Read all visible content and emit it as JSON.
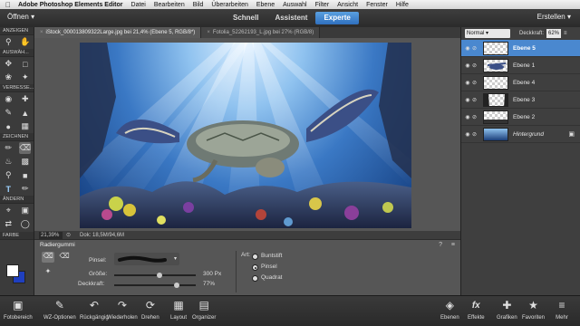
{
  "menubar": {
    "app_name": "Adobe Photoshop Elements Editor",
    "items": [
      "Datei",
      "Bearbeiten",
      "Bild",
      "Überarbeiten",
      "Ebene",
      "Auswahl",
      "Filter",
      "Ansicht",
      "Fenster",
      "Hilfe"
    ]
  },
  "modebar": {
    "open_label": "Öffnen",
    "tabs": [
      {
        "label": "Schnell",
        "active": false
      },
      {
        "label": "Assistent",
        "active": false
      },
      {
        "label": "Experte",
        "active": true
      }
    ],
    "create_label": "Erstellen"
  },
  "toolbox": {
    "sections": [
      "ANZEIGEN",
      "AUSWÄH...",
      "VERBESSE...",
      "ZEICHNEN",
      "ÄNDERN",
      "FARBE"
    ]
  },
  "doc_tabs": [
    {
      "label": "iStock_000013809322Large.jpg bei 21,4% (Ebene 5, RGB/8*)",
      "active": true
    },
    {
      "label": "Fotolia_52262193_L.jpg bei 27% (RGB/8)",
      "active": false
    }
  ],
  "status": {
    "zoom": "21,39%",
    "doc_info": "Dok: 18,5M/94,6M"
  },
  "layers_panel": {
    "blend_mode": "Normal",
    "opacity_label": "Deckkraft:",
    "opacity_value": "62%",
    "layers": [
      {
        "name": "Ebene 5",
        "selected": true
      },
      {
        "name": "Ebene 1",
        "selected": false
      },
      {
        "name": "Ebene 4",
        "selected": false
      },
      {
        "name": "Ebene 3",
        "selected": false
      },
      {
        "name": "Ebene 2",
        "selected": false
      },
      {
        "name": "Hintergrund",
        "selected": false
      }
    ]
  },
  "tool_options": {
    "title": "Radiergummi",
    "brush_label": "Pinsel:",
    "size_label": "Größe:",
    "size_value": "300 Px",
    "size_level": 0.55,
    "opacity_label": "Deckkraft:",
    "opacity_value": "77%",
    "opacity_level": 0.77,
    "type_label": "Art:",
    "types": [
      {
        "label": "Buntstift",
        "selected": false
      },
      {
        "label": "Pinsel",
        "selected": true
      },
      {
        "label": "Quadrat",
        "selected": false
      }
    ]
  },
  "bottombar": {
    "left": [
      {
        "label": "Fotobereich",
        "icon": "photo-bin-icon"
      },
      {
        "label": "WZ-Optionen",
        "icon": "tool-options-icon"
      },
      {
        "label": "Rückgängig",
        "icon": "undo-icon"
      },
      {
        "label": "Wiederholen",
        "icon": "redo-icon"
      },
      {
        "label": "Drehen",
        "icon": "rotate-icon"
      },
      {
        "label": "Layout",
        "icon": "layout-icon"
      },
      {
        "label": "Organizer",
        "icon": "organizer-icon"
      }
    ],
    "right": [
      {
        "label": "Ebenen",
        "icon": "layers-icon"
      },
      {
        "label": "Effekte",
        "icon": "effects-icon"
      },
      {
        "label": "Grafiken",
        "icon": "graphics-icon"
      },
      {
        "label": "Favoriten",
        "icon": "favorites-icon"
      },
      {
        "label": "Mehr",
        "icon": "more-icon"
      }
    ]
  }
}
